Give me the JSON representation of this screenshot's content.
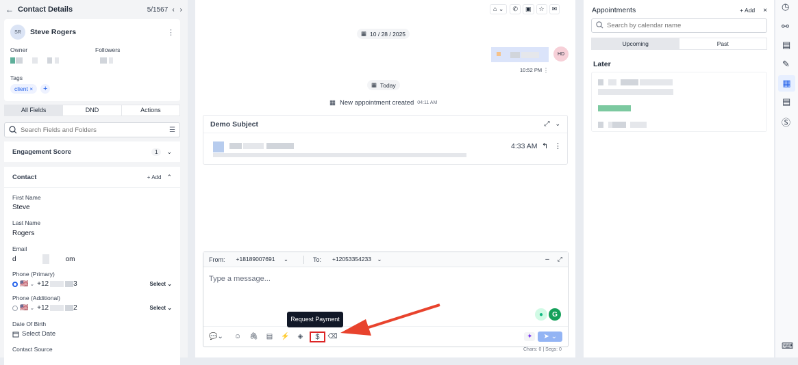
{
  "left": {
    "back_label": "Contact Details",
    "pager": "5/1567",
    "contact": {
      "initials": "SR",
      "name": "Steve Rogers"
    },
    "owner_label": "Owner",
    "followers_label": "Followers",
    "tags_label": "Tags",
    "tags": [
      "client"
    ],
    "tabs": [
      "All Fields",
      "DND",
      "Actions"
    ],
    "search_placeholder": "Search Fields and Folders",
    "engagement": {
      "label": "Engagement Score",
      "value": "1"
    },
    "contact_section": {
      "label": "Contact",
      "add_label": "Add"
    },
    "fields": {
      "first_name_label": "First Name",
      "first_name": "Steve",
      "last_name_label": "Last Name",
      "last_name": "Rogers",
      "email_label": "Email",
      "email_start": "d",
      "email_end": "om",
      "phone_primary_label": "Phone (Primary)",
      "phone_primary_start": "+12",
      "phone_primary_end": "3",
      "phone_additional_label": "Phone (Additional)",
      "phone_additional_start": "+12",
      "phone_additional_end": "2",
      "select_label": "Select",
      "dob_label": "Date Of Birth",
      "dob_placeholder": "Select Date",
      "source_label": "Contact Source"
    }
  },
  "center": {
    "date_pill": "10 / 28 / 2025",
    "msg_time": "10:52 PM",
    "avatar_initials": "HD",
    "today_pill": "Today",
    "appointment_note": "New appointment created",
    "appointment_time": "04:11 AM",
    "email_subject": "Demo Subject",
    "email_time": "4:33 AM",
    "composer": {
      "from_label": "From:",
      "from_number": "+18189007691",
      "to_label": "To:",
      "to_number": "+12053354233",
      "placeholder": "Type a message...",
      "tooltip": "Request Payment",
      "counter": "Chars: 0 | Segs: 0"
    }
  },
  "right": {
    "title": "Appointments",
    "add_label": "Add",
    "search_placeholder": "Search by calendar name",
    "tabs": [
      "Upcoming",
      "Past"
    ],
    "later_label": "Later"
  },
  "colors": {
    "accent": "#2563eb",
    "arrow": "#e8432d",
    "highlight": "#dc2626"
  }
}
